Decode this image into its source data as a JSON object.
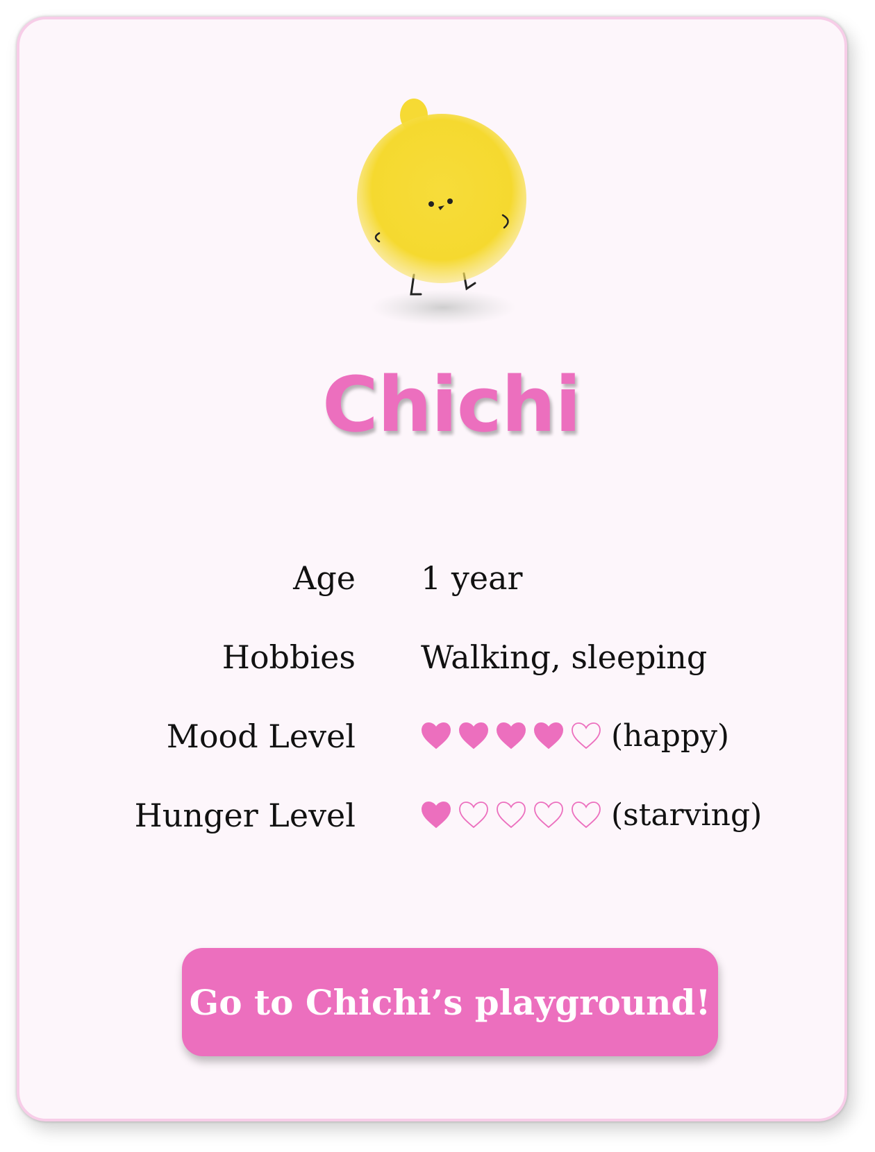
{
  "pet": {
    "name": "Chichi",
    "mascot_icon": "yellow-chick-icon"
  },
  "stats": [
    {
      "label": "Age",
      "value": "1 year"
    },
    {
      "label": "Hobbies",
      "value": "Walking, sleeping"
    },
    {
      "label": "Mood Level",
      "hearts_filled": 4,
      "hearts_total": 5,
      "note": "(happy)"
    },
    {
      "label": "Hunger Level",
      "hearts_filled": 1,
      "hearts_total": 5,
      "note": "(starving)"
    }
  ],
  "cta": {
    "label": "Go to Chichi’s playground!"
  },
  "colors": {
    "accent": "#ec6fbe",
    "card_bg": "#fdf6fb",
    "card_border": "#f7cde8",
    "mascot": "#f6d832"
  }
}
